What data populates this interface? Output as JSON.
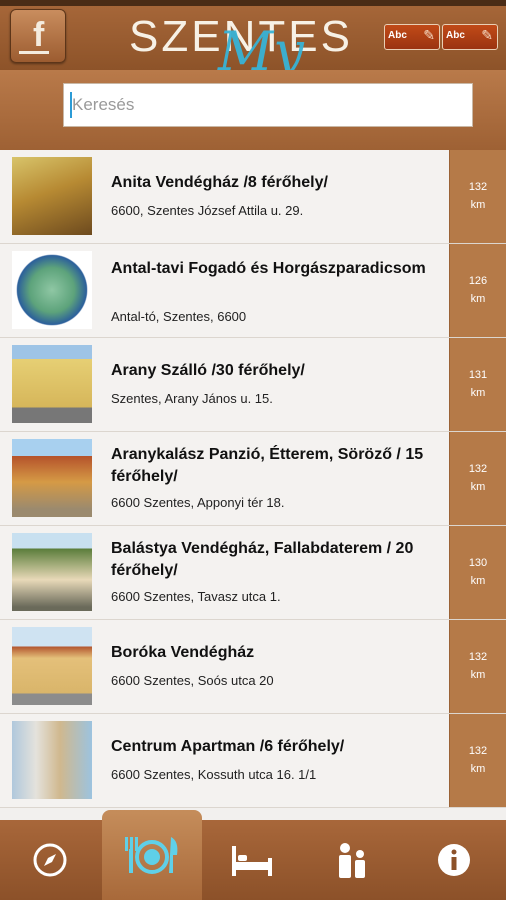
{
  "header": {
    "facebook_icon": "facebook-icon",
    "logo_text": "SZENTES",
    "logo_overlay": "My",
    "font_buttons": [
      {
        "label": "Abc"
      },
      {
        "label": "Abc"
      }
    ]
  },
  "search": {
    "placeholder": "Keresés"
  },
  "items": [
    {
      "name": "Anita Vendégház /8 férőhely/",
      "address": "6600, Szentes József Attila u. 29.",
      "distance": "132\nkm"
    },
    {
      "name": "Antal-tavi Fogadó és Horgászparadicsom",
      "address": "Antal-tó, Szentes, 6600",
      "distance": "126\nkm"
    },
    {
      "name": "Arany Szálló /30 férőhely/",
      "address": "Szentes, Arany János u. 15.",
      "distance": "131\nkm"
    },
    {
      "name": "Aranykalász Panzió, Étterem, Söröző / 15 férőhely/",
      "address": "6600 Szentes, Apponyi tér 18.",
      "distance": "132\nkm"
    },
    {
      "name": "Balástya Vendégház, Fallabdaterem / 20 férőhely/",
      "address": "6600 Szentes, Tavasz utca 1.",
      "distance": "130\nkm"
    },
    {
      "name": "Boróka Vendégház",
      "address": "6600 Szentes, Soós utca 20",
      "distance": "132\nkm"
    },
    {
      "name": "Centrum Apartman /6 férőhely/",
      "address": "6600 Szentes, Kossuth utca 16. 1/1",
      "distance": "132\nkm"
    }
  ],
  "nav": [
    {
      "icon": "compass-icon",
      "active": false
    },
    {
      "icon": "restaurant-icon",
      "active": true
    },
    {
      "icon": "bed-icon",
      "active": false
    },
    {
      "icon": "family-icon",
      "active": false
    },
    {
      "icon": "info-icon",
      "active": false
    }
  ]
}
